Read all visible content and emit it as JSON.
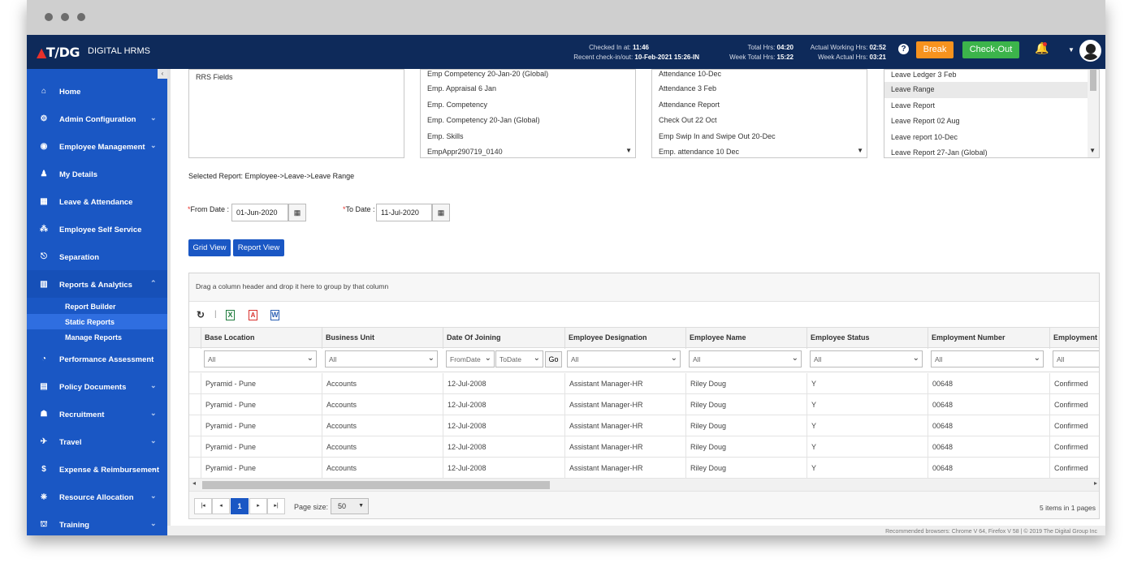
{
  "app": {
    "brand_logo": "T/DG",
    "brand_name": "DIGITAL HRMS"
  },
  "header": {
    "checked_in_label": "Checked In at:",
    "checked_in_value": "11:46",
    "recent_label": "Recent check-in/out:",
    "recent_value": "10-Feb-2021 15:26-IN",
    "total_hrs_label": "Total Hrs:",
    "total_hrs_value": "04:20",
    "week_total_label": "Week Total Hrs:",
    "week_total_value": "15:22",
    "actual_working_label": "Actual Working Hrs:",
    "actual_working_value": "02:52",
    "week_actual_label": "Week Actual Hrs:",
    "week_actual_value": "03:21",
    "help_icon": "?",
    "break_label": "Break",
    "checkout_label": "Check-Out"
  },
  "sidebar": {
    "items": [
      {
        "label": "Home",
        "icon": "home-icon"
      },
      {
        "label": "Admin Configuration",
        "icon": "gear-icon"
      },
      {
        "label": "Employee Management",
        "icon": "user-circle-icon"
      },
      {
        "label": "My Details",
        "icon": "person-icon"
      },
      {
        "label": "Leave & Attendance",
        "icon": "calendar-icon"
      },
      {
        "label": "Employee Self Service",
        "icon": "network-icon"
      },
      {
        "label": "Separation",
        "icon": "exit-icon"
      },
      {
        "label": "Reports & Analytics",
        "icon": "chart-icon"
      },
      {
        "label": "Performance Assessment",
        "icon": "gauge-icon"
      },
      {
        "label": "Policy Documents",
        "icon": "document-icon"
      },
      {
        "label": "Recruitment",
        "icon": "group-icon"
      },
      {
        "label": "Travel",
        "icon": "plane-icon"
      },
      {
        "label": "Expense & Reimbursement",
        "icon": "money-icon"
      },
      {
        "label": "Resource Allocation",
        "icon": "share-icon"
      },
      {
        "label": "Training",
        "icon": "training-icon"
      }
    ],
    "sub_items": [
      "Report Builder",
      "Static Reports",
      "Manage Reports"
    ]
  },
  "report_lists": {
    "list1": [
      "RRS Fields"
    ],
    "list2": [
      "Emp Competency 20-Jan-20 (Global)",
      "Emp. Appraisal 6 Jan",
      "Emp. Competency",
      "Emp. Competency 20-Jan (Global)",
      "Emp. Skills",
      "EmpAppr290719_0140"
    ],
    "list3": [
      "Attendance 10-Dec",
      "Attendance 3 Feb",
      "Attendance Report",
      "Check Out 22 Oct",
      "Emp Swip In and Swipe Out 20-Dec",
      "Emp. attendance 10 Dec"
    ],
    "list4": [
      "Leave Ledger 3 Feb",
      "Leave Range",
      "Leave Report",
      "Leave Report 02 Aug",
      "Leave report 10-Dec",
      "Leave Report 27-Jan (Global)"
    ]
  },
  "selected_report": "Selected Report: Employee->Leave->Leave Range",
  "filters": {
    "from_label": "From Date :",
    "from_value": "01-Jun-2020",
    "to_label": "To Date :",
    "to_value": "11-Jul-2020",
    "required_mark": "*"
  },
  "view_buttons": {
    "grid": "Grid View",
    "report": "Report View"
  },
  "grid": {
    "group_hint": "Drag a column header and drop it here to group by that column",
    "columns": [
      "Base Location",
      "Business Unit",
      "Date Of Joining",
      "Employee Designation",
      "Employee Name",
      "Employee Status",
      "Employment Number",
      "Employment S"
    ],
    "filter_all": "All",
    "filter_from": "FromDate",
    "filter_to": "ToDate",
    "go_label": "Go",
    "rows": [
      [
        "Pyramid - Pune",
        "Accounts",
        "12-Jul-2008",
        "Assistant Manager-HR",
        "Riley Doug",
        "Y",
        "00648",
        "Confirmed"
      ],
      [
        "Pyramid - Pune",
        "Accounts",
        "12-Jul-2008",
        "Assistant Manager-HR",
        "Riley Doug",
        "Y",
        "00648",
        "Confirmed"
      ],
      [
        "Pyramid - Pune",
        "Accounts",
        "12-Jul-2008",
        "Assistant Manager-HR",
        "Riley Doug",
        "Y",
        "00648",
        "Confirmed"
      ],
      [
        "Pyramid - Pune",
        "Accounts",
        "12-Jul-2008",
        "Assistant Manager-HR",
        "Riley Doug",
        "Y",
        "00648",
        "Confirmed"
      ],
      [
        "Pyramid - Pune",
        "Accounts",
        "12-Jul-2008",
        "Assistant Manager-HR",
        "Riley Doug",
        "Y",
        "00648",
        "Confirmed"
      ]
    ],
    "pager": {
      "current_page": "1",
      "page_size_label": "Page size:",
      "page_size_value": "50",
      "items_info": "5 items in 1 pages"
    }
  },
  "footer": "Recommended browsers: Chrome V 64, Firefox V 58  |  © 2019 The Digital Group Inc",
  "colors": {
    "topbar": "#0e2a5a",
    "sidebar": "#1a57c4",
    "break": "#f7931e",
    "checkout": "#3cb44b"
  }
}
